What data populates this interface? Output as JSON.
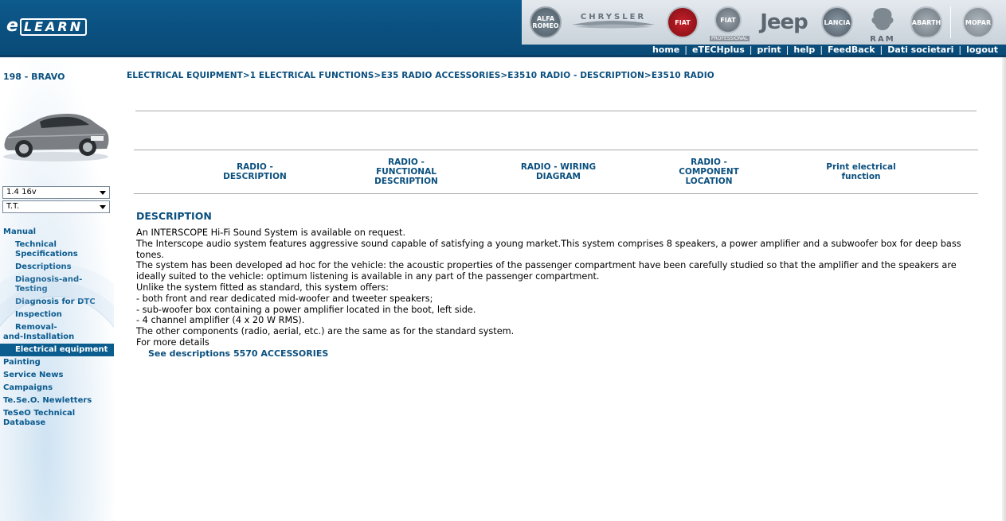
{
  "header": {
    "logo_e": "e",
    "logo_learn": "LEARN",
    "brands": {
      "alfa": "ALFA ROMEO",
      "chrysler": "CHRYSLER",
      "fiat": "FIAT",
      "fiat_pro": "FIAT",
      "fiat_pro_sub": "PROFESSIONAL",
      "jeep": "Jeep",
      "lancia": "LANCIA",
      "ram": "RAM",
      "abarth": "ABARTH",
      "mopar": "MOPAR"
    },
    "nav": [
      "home",
      "eTECHplus",
      "print",
      "help",
      "FeedBack",
      "Dati societari",
      "logout"
    ]
  },
  "sidebar": {
    "model": "198 - BRAVO",
    "engine_select": "1.4 16v",
    "type_select": "T.T.",
    "menu": [
      {
        "label": "Manual",
        "level": 0
      },
      {
        "label": "Technical Specifications",
        "level": 1
      },
      {
        "label": "Descriptions",
        "level": 1
      },
      {
        "label": "Diagnosis-and-Testing",
        "level": 1
      },
      {
        "label": "Diagnosis for DTC",
        "level": 1
      },
      {
        "label": "Inspection",
        "level": 1
      },
      {
        "label": "Removal-and-Installation",
        "level": 1
      },
      {
        "label": "Electrical equipment",
        "level": 1,
        "active": true
      },
      {
        "label": "Painting",
        "level": 0
      },
      {
        "label": "Service News",
        "level": 0
      },
      {
        "label": "Campaigns",
        "level": 0
      },
      {
        "label": "Te.Se.O. Newletters",
        "level": 0
      },
      {
        "label": "TeSeO Technical Database",
        "level": 0
      }
    ]
  },
  "breadcrumb": "ELECTRICAL EQUIPMENT>1 ELECTRICAL FUNCTIONS>E35 RADIO ACCESSORIES>E3510 RADIO - DESCRIPTION>E3510 RADIO",
  "tabs": [
    {
      "line1": "RADIO -",
      "line2": "DESCRIPTION",
      "line3": ""
    },
    {
      "line1": "RADIO -",
      "line2": "FUNCTIONAL",
      "line3": "DESCRIPTION"
    },
    {
      "line1": "RADIO - WIRING",
      "line2": "DIAGRAM",
      "line3": ""
    },
    {
      "line1": "RADIO -",
      "line2": "COMPONENT",
      "line3": "LOCATION"
    },
    {
      "line1": "Print electrical",
      "line2": "function",
      "line3": ""
    }
  ],
  "description": {
    "title": "DESCRIPTION",
    "lines": [
      "An INTERSCOPE Hi-Fi Sound System is available on request.",
      "The Interscope audio system features aggressive sound capable of satisfying a young market.This system comprises 8 speakers, a power amplifier and a subwoofer box for deep bass tones.",
      "The system has been developed ad hoc for the vehicle: the acoustic properties of the passenger compartment have been carefully studied so that the amplifier and the speakers are ideally suited to the vehicle: optimum listening is available in any part of the passenger compartment.",
      "Unlike the system fitted as standard, this system offers:",
      "- both front and rear dedicated mid-woofer and tweeter speakers;",
      "- sub-woofer box containing a power amplifier located in the boot, left side.",
      "- 4 channel amplifier (4 x 20 W RMS).",
      "The other components (radio, aerial, etc.) are the same as for the standard system.",
      "For more details"
    ],
    "link": "See descriptions 5570 ACCESSORIES"
  }
}
